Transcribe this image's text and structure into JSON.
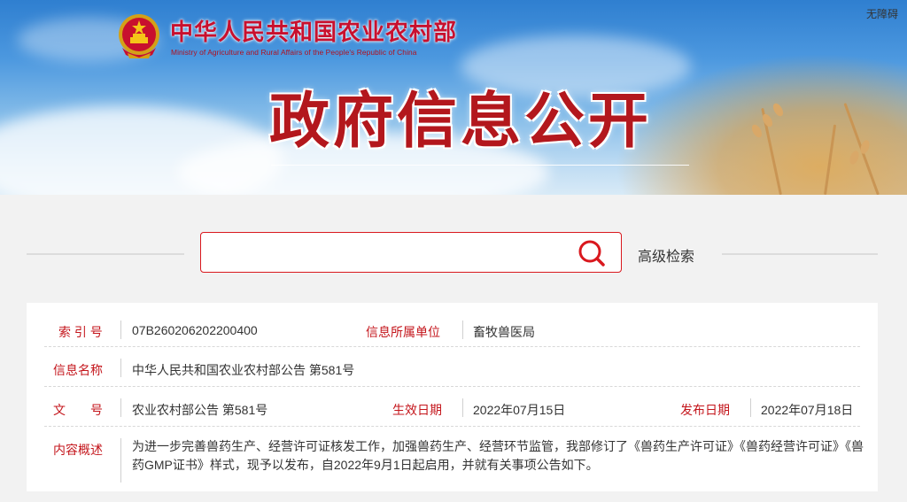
{
  "header": {
    "site_title": "中华人民共和国农业农村部",
    "site_subtitle": "Ministry of Agriculture and Rural Affairs of the People's Republic of China",
    "section_title": "政府信息公开",
    "accessibility_link": "无障碍"
  },
  "search": {
    "placeholder": "",
    "value": "",
    "advanced_label": "高级检索"
  },
  "info": {
    "index_label": "索 引 号",
    "index_value": "07B260206202200400",
    "unit_label": "信息所属单位",
    "unit_value": "畜牧兽医局",
    "name_label": "信息名称",
    "name_value": "中华人民共和国农业农村部公告 第581号",
    "doc_label": "文　　号",
    "doc_value": "农业农村部公告 第581号",
    "effective_label": "生效日期",
    "effective_value": "2022年07月15日",
    "publish_label": "发布日期",
    "publish_value": "2022年07月18日",
    "summary_label": "内容概述",
    "summary_value": "为进一步完善兽药生产、经营许可证核发工作，加强兽药生产、经营环节监管，我部修订了《兽药生产许可证》《兽药经营许可证》《兽药GMP证书》样式，现予以发布，自2022年9月1日起启用，并就有关事项公告如下。"
  },
  "colors": {
    "brand_red": "#c4161c",
    "search_border": "#d9181e"
  },
  "icons": {
    "emblem": "national-emblem-icon",
    "search": "search-icon"
  }
}
